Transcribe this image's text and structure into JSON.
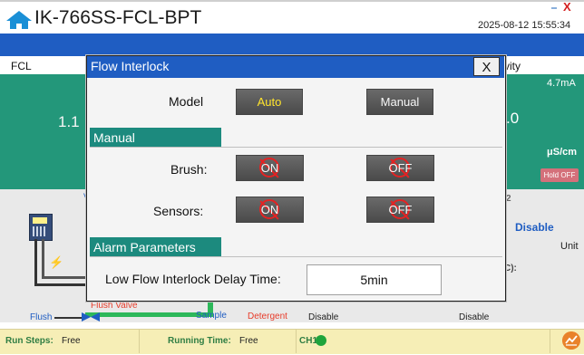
{
  "header": {
    "app_title": "IK-766SS-FCL-BPT",
    "timestamp": "2025-08-12 15:55:34"
  },
  "background": {
    "left_panel_label": "FCL",
    "left_value": "1.1",
    "left_sub_label": "V",
    "right_panel_label": "vity",
    "right_ma": "4.7mA",
    "right_value": ".0",
    "right_unit": "μS/cm",
    "hold_off": "Hold OFF",
    "right_2": "2",
    "right_disable": "Disable",
    "right_unit_label": "Unit",
    "right_c_label": "C):",
    "flush": "Flush",
    "flush_valve": "Flush Valve",
    "sample": "Sample",
    "detergent": "Detergent",
    "disable_1": "Disable",
    "disable_2": "Disable"
  },
  "status_bar": {
    "run_steps_key": "Run Steps:",
    "run_steps_val": "Free",
    "running_time_key": "Running Time:",
    "running_time_val": "Free",
    "ch1_key": "CH1:"
  },
  "modal": {
    "title": "Flow Interlock",
    "close": "X",
    "model_label": "Model",
    "auto": "Auto",
    "manual": "Manual",
    "manual_section": "Manual",
    "brush_label": "Brush:",
    "sensors_label": "Sensors:",
    "on": "ON",
    "off": "OFF",
    "alarm_section": "Alarm Parameters",
    "delay_label": "Low Flow Interlock Delay Time:",
    "delay_value": "5min"
  },
  "colors": {
    "header_blue": "#1f5dc2",
    "section_teal": "#1c8a7e",
    "panel_green": "#23977a",
    "auto_text": "#ffe42c",
    "prohibit_red": "#e52222",
    "status_bar_bg": "#f6eeb6"
  },
  "icons": [
    "home-icon",
    "minimize-icon",
    "close-icon",
    "bolt-icon",
    "valve-icon",
    "chart-icon",
    "prohibit-icon"
  ]
}
